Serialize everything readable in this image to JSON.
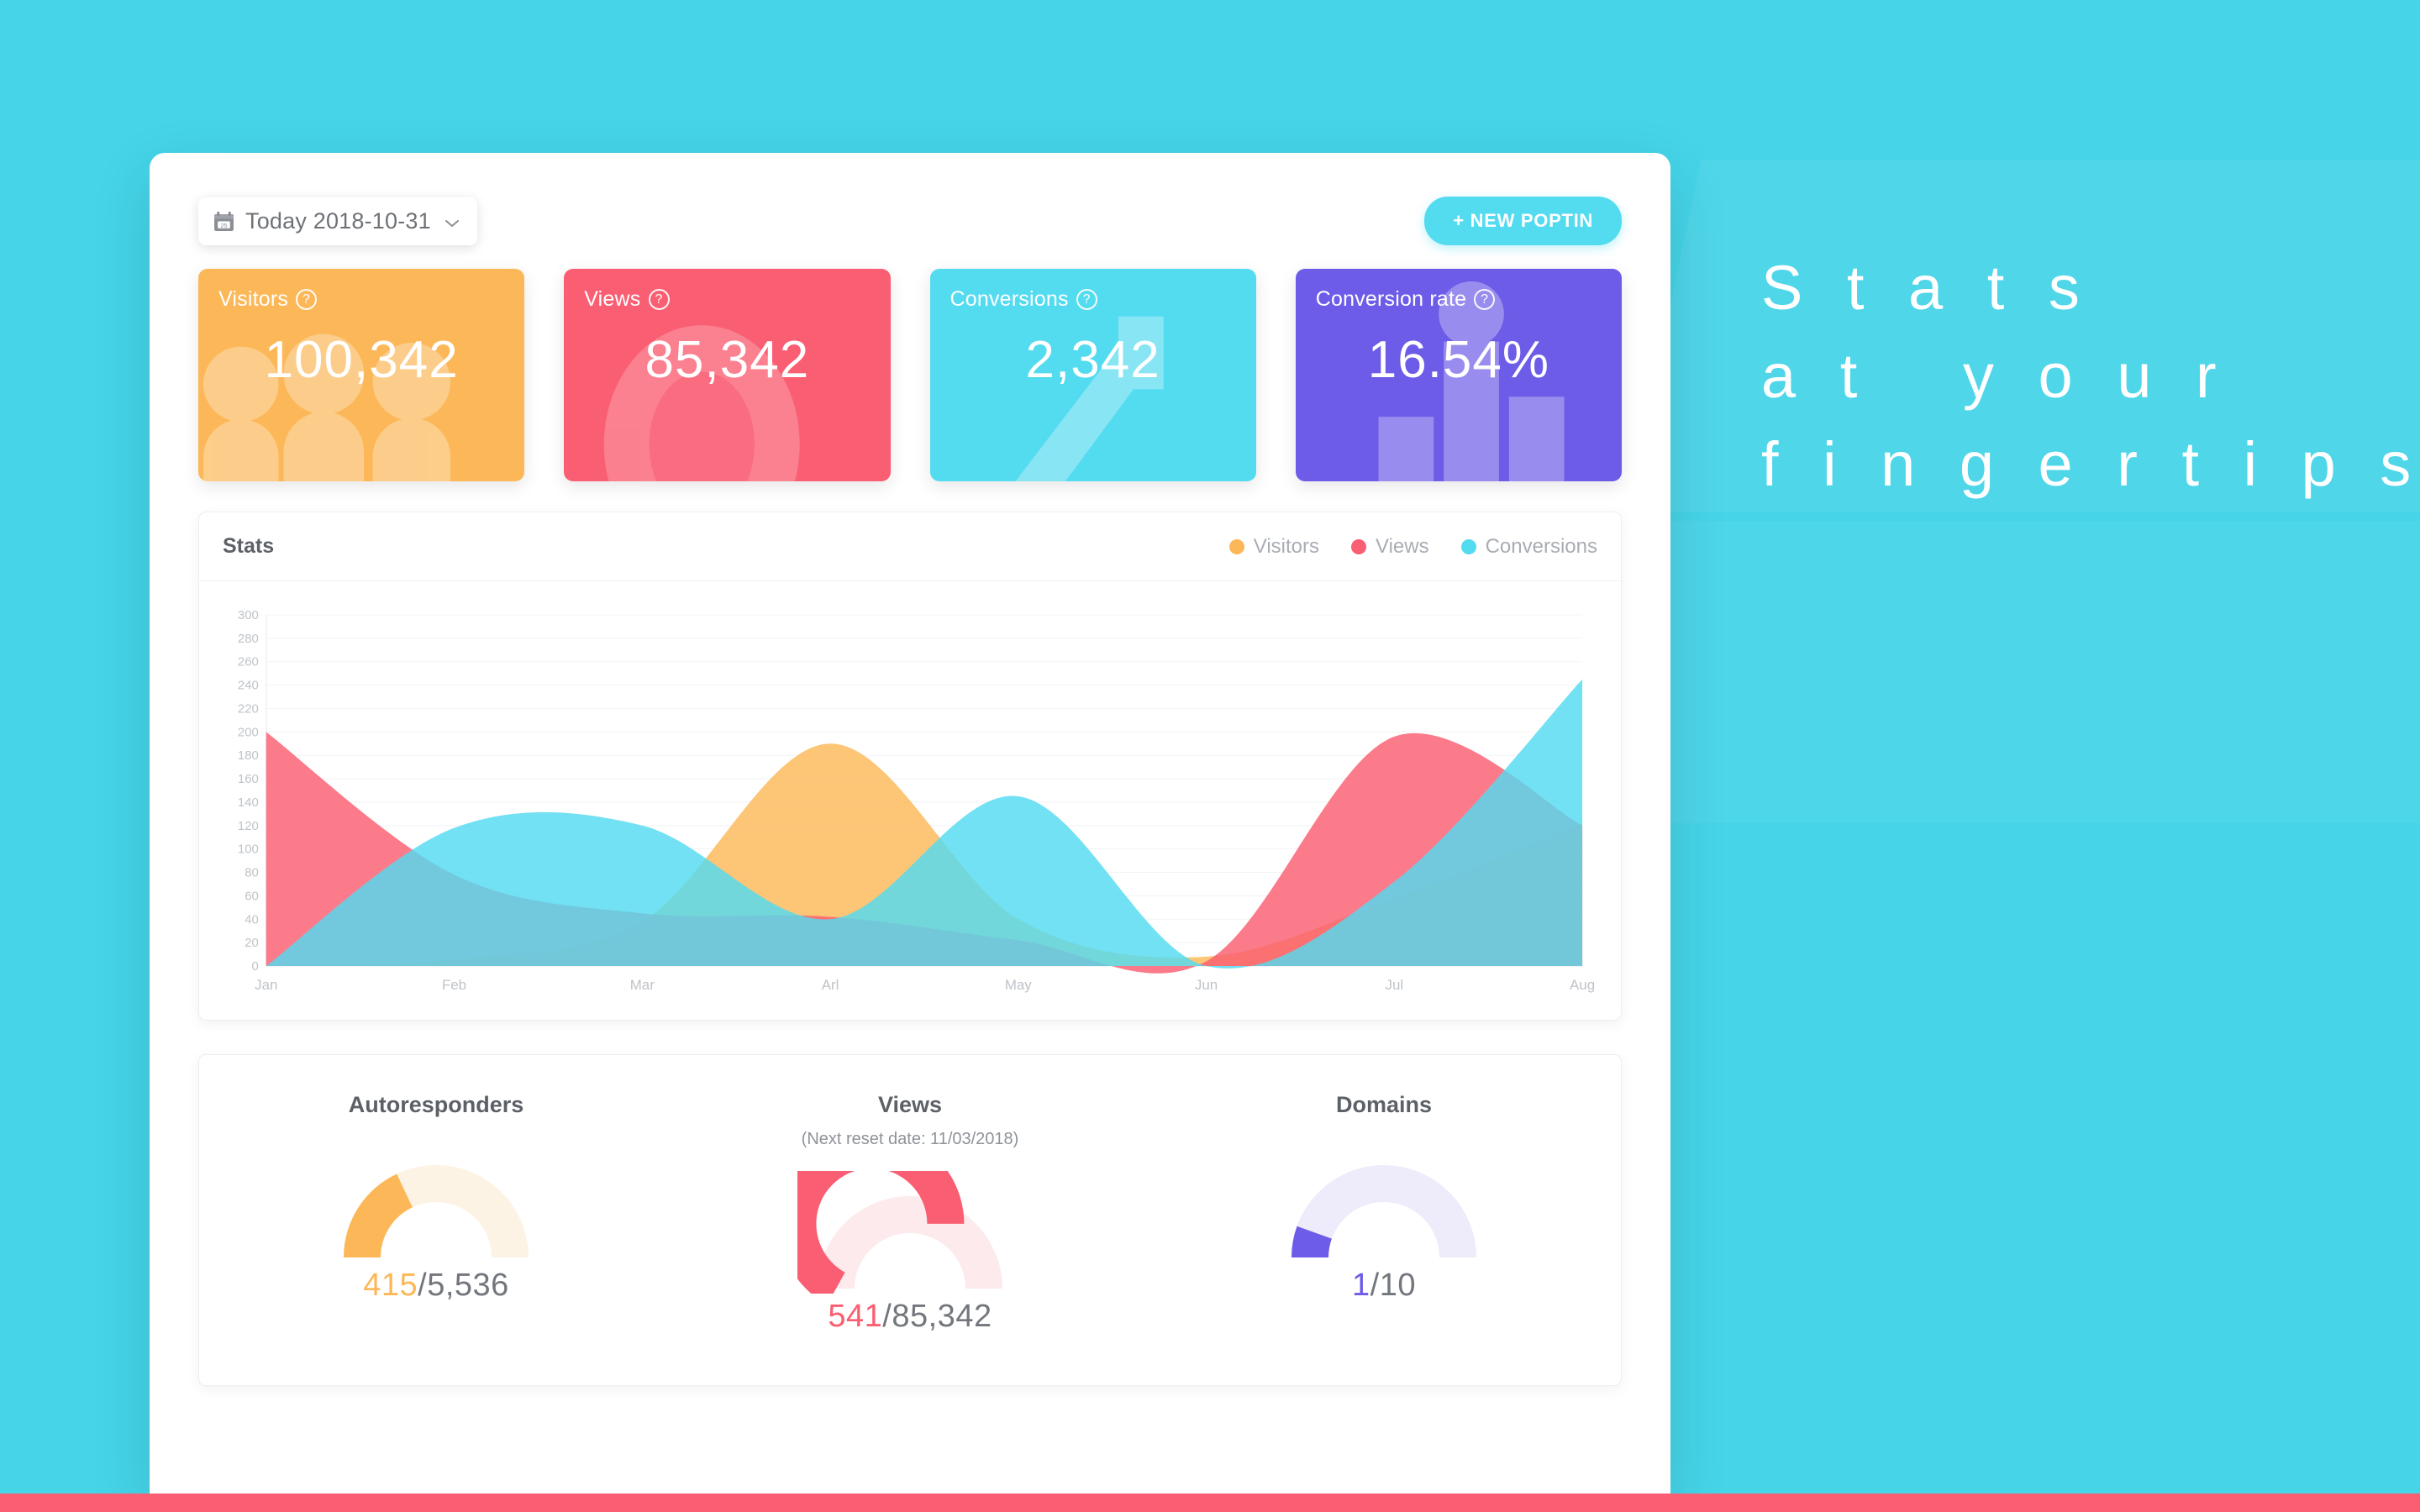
{
  "theme": {
    "background": "#45d4e8",
    "accent_cyan": "#53dbf0",
    "accent_orange": "#fcb858",
    "accent_red": "#fa5e72",
    "accent_purple": "#6c5ce7",
    "bottom_bar": "#fa5e72"
  },
  "toolbar": {
    "date_label": "Today 2018-10-31",
    "calendar_icon": "calendar-icon",
    "chevron_icon": "chevron-down-icon",
    "new_poptin_label": "+ NEW POPTIN"
  },
  "stat_cards": [
    {
      "label": "Visitors",
      "value": "100,342",
      "bg": "#fcb858",
      "watermark": "people-icon",
      "help_icon": "help-icon"
    },
    {
      "label": "Views",
      "value": "85,342",
      "bg": "#fa5e72",
      "watermark": "eye-icon",
      "help_icon": "help-icon"
    },
    {
      "label": "Conversions",
      "value": "2,342",
      "bg": "#53dbf0",
      "watermark": "arrow-up-icon",
      "help_icon": "help-icon"
    },
    {
      "label": "Conversion rate",
      "value": "16.54%",
      "bg": "#6c5ce7",
      "watermark": "bar-chart-icon",
      "help_icon": "help-icon"
    }
  ],
  "stats_panel": {
    "title": "Stats",
    "legend": [
      {
        "label": "Visitors",
        "color": "#fcb858"
      },
      {
        "label": "Views",
        "color": "#fa5e72"
      },
      {
        "label": "Conversions",
        "color": "#53dbf0"
      }
    ]
  },
  "chart_data": {
    "type": "area",
    "title": "Stats",
    "xlabel": "",
    "ylabel": "",
    "categories": [
      "Jan",
      "Feb",
      "Mar",
      "Arl",
      "May",
      "Jun",
      "Jul",
      "Aug"
    ],
    "ylim": [
      0,
      300
    ],
    "yticks": [
      0,
      20,
      40,
      60,
      80,
      100,
      120,
      140,
      160,
      180,
      200,
      220,
      240,
      260,
      280,
      300
    ],
    "grid": true,
    "legend_position": "top-right",
    "series": [
      {
        "name": "Visitors",
        "color": "#fcb858",
        "values": [
          0,
          6,
          38,
          190,
          40,
          8,
          58,
          122
        ]
      },
      {
        "name": "Views",
        "color": "#fa5e72",
        "values": [
          200,
          78,
          45,
          42,
          22,
          4,
          196,
          120
        ]
      },
      {
        "name": "Conversions",
        "color": "#53dbf0",
        "values": [
          0,
          118,
          120,
          40,
          145,
          0,
          72,
          245
        ]
      }
    ]
  },
  "gauges": [
    {
      "title": "Autoresponders",
      "subtitle": "",
      "current": "415",
      "total": "5,536",
      "percent": 36,
      "color": "#fcb858",
      "track": "#fdf3e5"
    },
    {
      "title": "Views",
      "subtitle": "(Next reset date: 11/03/2018)",
      "current": "541",
      "total": "85,342",
      "percent": 66,
      "color": "#fa5e72",
      "track": "#fdeaec"
    },
    {
      "title": "Domains",
      "subtitle": "",
      "current": "1",
      "total": "10",
      "percent": 11,
      "color": "#6c5ce7",
      "track": "#eeecfb"
    }
  ],
  "tagline": {
    "line1": "S t a t s",
    "line2": "a t   y o u r",
    "line3": "f i n g e r t i p s"
  }
}
